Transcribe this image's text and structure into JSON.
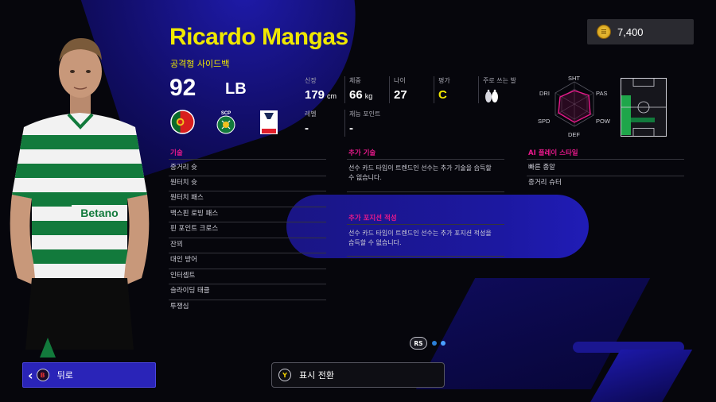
{
  "currency": {
    "icon": "coin-icon",
    "value": "7,400"
  },
  "player": {
    "name": "Ricardo Mangas",
    "subtitle": "공격형 사이드백",
    "overall": "92",
    "position": "LB",
    "nation_badge": "portugal-flag-icon",
    "club_badge": "sporting-cp-crest-icon",
    "league_badge": "liga-portugal-logo-icon",
    "league_logo_text": "LIGA PORTUGAL Betclic",
    "club_logo_text": "SCP"
  },
  "stats": {
    "height": {
      "label": "신장",
      "value": "179",
      "unit": "cm"
    },
    "weight": {
      "label": "체중",
      "value": "66",
      "unit": "kg"
    },
    "age": {
      "label": "나이",
      "value": "27"
    },
    "rating": {
      "label": "평가",
      "value": "C"
    },
    "foot": {
      "label": "주로 쓰는 발",
      "icon": "feet-icon"
    },
    "level": {
      "label": "레벨",
      "value": "-"
    },
    "skill_points": {
      "label": "재능 포인트",
      "value": "-"
    }
  },
  "radar": {
    "labels": {
      "sht": "SHT",
      "pas": "PAS",
      "dri": "DRI",
      "pow": "POW",
      "spd": "SPD",
      "def": "DEF"
    },
    "accent": "#e8198b"
  },
  "skills": {
    "title": "기술",
    "items": [
      "중거리 슛",
      "원터치 슛",
      "원터치 패스",
      "백스핀 로빙 패스",
      "핀 포인트 크로스",
      "잔꾀",
      "대인 방어",
      "인터셉트",
      "슬라이딩 태클",
      "투쟁심"
    ]
  },
  "additional_skills": {
    "title": "추가 기술",
    "description": "선수 카드 타입이 트렌드인 선수는 추가 기술을 습득할 수 없습니다."
  },
  "additional_positions": {
    "title": "추가 포지션 적성",
    "description": "선수 카드 타입이 트렌드인 선수는 추가 포지션 적성을 습득할 수 없습니다."
  },
  "ai_styles": {
    "title": "AI 플레이 스타일",
    "items": [
      "빠른 종알",
      "중거리 슈터"
    ]
  },
  "pager": {
    "rs_label": "RS"
  },
  "footer": {
    "back_key": "B",
    "back_label": "뒤로",
    "toggle_key": "Y",
    "toggle_label": "표시 전환"
  },
  "colors": {
    "name_yellow": "#f0e800",
    "section_pink": "#e8198b",
    "back_button": "#2a24b8",
    "position_green": "#1fa64a"
  }
}
